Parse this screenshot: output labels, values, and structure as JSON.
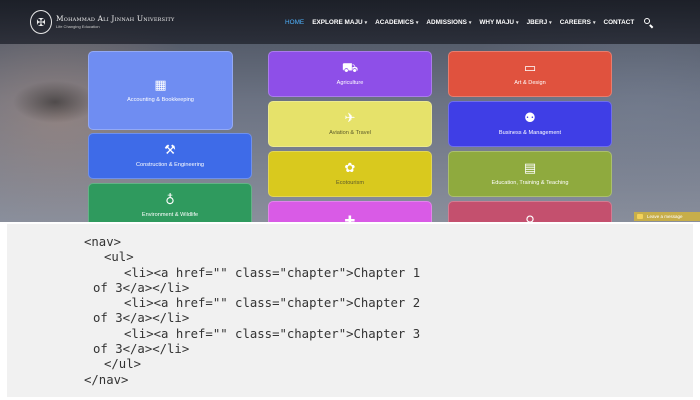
{
  "site": {
    "logo_mark": "✠",
    "name": "Mohammad Ali Jinnah University",
    "tagline": "Life Changing Education",
    "nav": [
      {
        "label": "HOME",
        "dropdown": false,
        "active": true
      },
      {
        "label": "EXPLORE MAJU",
        "dropdown": true,
        "active": false
      },
      {
        "label": "ACADEMICS",
        "dropdown": true,
        "active": false
      },
      {
        "label": "ADMISSIONS",
        "dropdown": true,
        "active": false
      },
      {
        "label": "WHY MAJU",
        "dropdown": true,
        "active": false
      },
      {
        "label": "JBERJ",
        "dropdown": true,
        "active": false
      },
      {
        "label": "CAREERS",
        "dropdown": true,
        "active": false
      },
      {
        "label": "CONTACT",
        "dropdown": false,
        "active": false
      }
    ],
    "tiles": [
      {
        "label": "Accounting & Bookkeeping",
        "icon": "calculator-icon",
        "glyph": "▦",
        "color": "#6f8df2"
      },
      {
        "label": "Agriculture",
        "icon": "tractor-icon",
        "glyph": "⛟",
        "color": "#8e4fe8"
      },
      {
        "label": "Art & Design",
        "icon": "monitor-icon",
        "glyph": "▭",
        "color": "#e0523e"
      },
      {
        "label": "Aviation & Travel",
        "icon": "airplane-icon",
        "glyph": "✈",
        "color": "#e6e26a"
      },
      {
        "label": "Business & Management",
        "icon": "business-people-icon",
        "glyph": "⚉",
        "color": "#3f3ee6"
      },
      {
        "label": "Construction & Engineering",
        "icon": "crane-icon",
        "glyph": "⚒",
        "color": "#3e6be8"
      },
      {
        "label": "Ecotourism",
        "icon": "ecotourism-icon",
        "glyph": "✿",
        "color": "#d9c91e"
      },
      {
        "label": "Education, Training & Teaching",
        "icon": "presentation-icon",
        "glyph": "▤",
        "color": "#8faa3e"
      },
      {
        "label": "Environment & Wildlife",
        "icon": "globe-leaf-icon",
        "glyph": "♁",
        "color": "#2f9a5e"
      },
      {
        "label": "",
        "icon": "health-icon",
        "glyph": "✚",
        "color": "#d95be6"
      },
      {
        "label": "",
        "icon": "person-icon",
        "glyph": "♀",
        "color": "#c4506e"
      }
    ],
    "chat": {
      "label": "Leave a message"
    }
  },
  "code": {
    "lines": [
      "<nav>",
      "<ul>",
      "<li><a href=\"\" class=\"chapter\">Chapter 1",
      "of 3</a></li>",
      "<li><a href=\"\" class=\"chapter\">Chapter 2",
      "of 3</a></li>",
      "<li><a href=\"\" class=\"chapter\">Chapter 3",
      "of 3</a></li>",
      "</ul>",
      "</nav>"
    ]
  }
}
